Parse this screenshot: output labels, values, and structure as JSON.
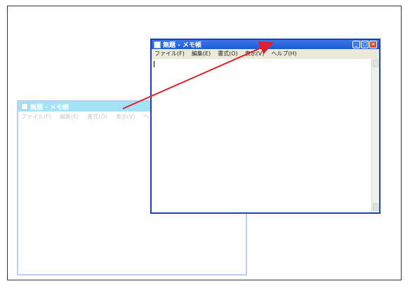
{
  "ghost_window": {
    "title": "無題 - メモ帳",
    "menu": [
      "ファイル(F)",
      "編集(E)",
      "書式(O)",
      "表示(V)",
      "ヘルプ(H)"
    ]
  },
  "window": {
    "title": "無題 - メモ帳",
    "menu": [
      "ファイル(F)",
      "編集(E)",
      "書式(O)",
      "表示(V)",
      "ヘルプ(H)"
    ],
    "controls": {
      "minimize": "_",
      "maximize": "□",
      "close": "×"
    }
  },
  "drag_arrow_color": "#e0202a"
}
